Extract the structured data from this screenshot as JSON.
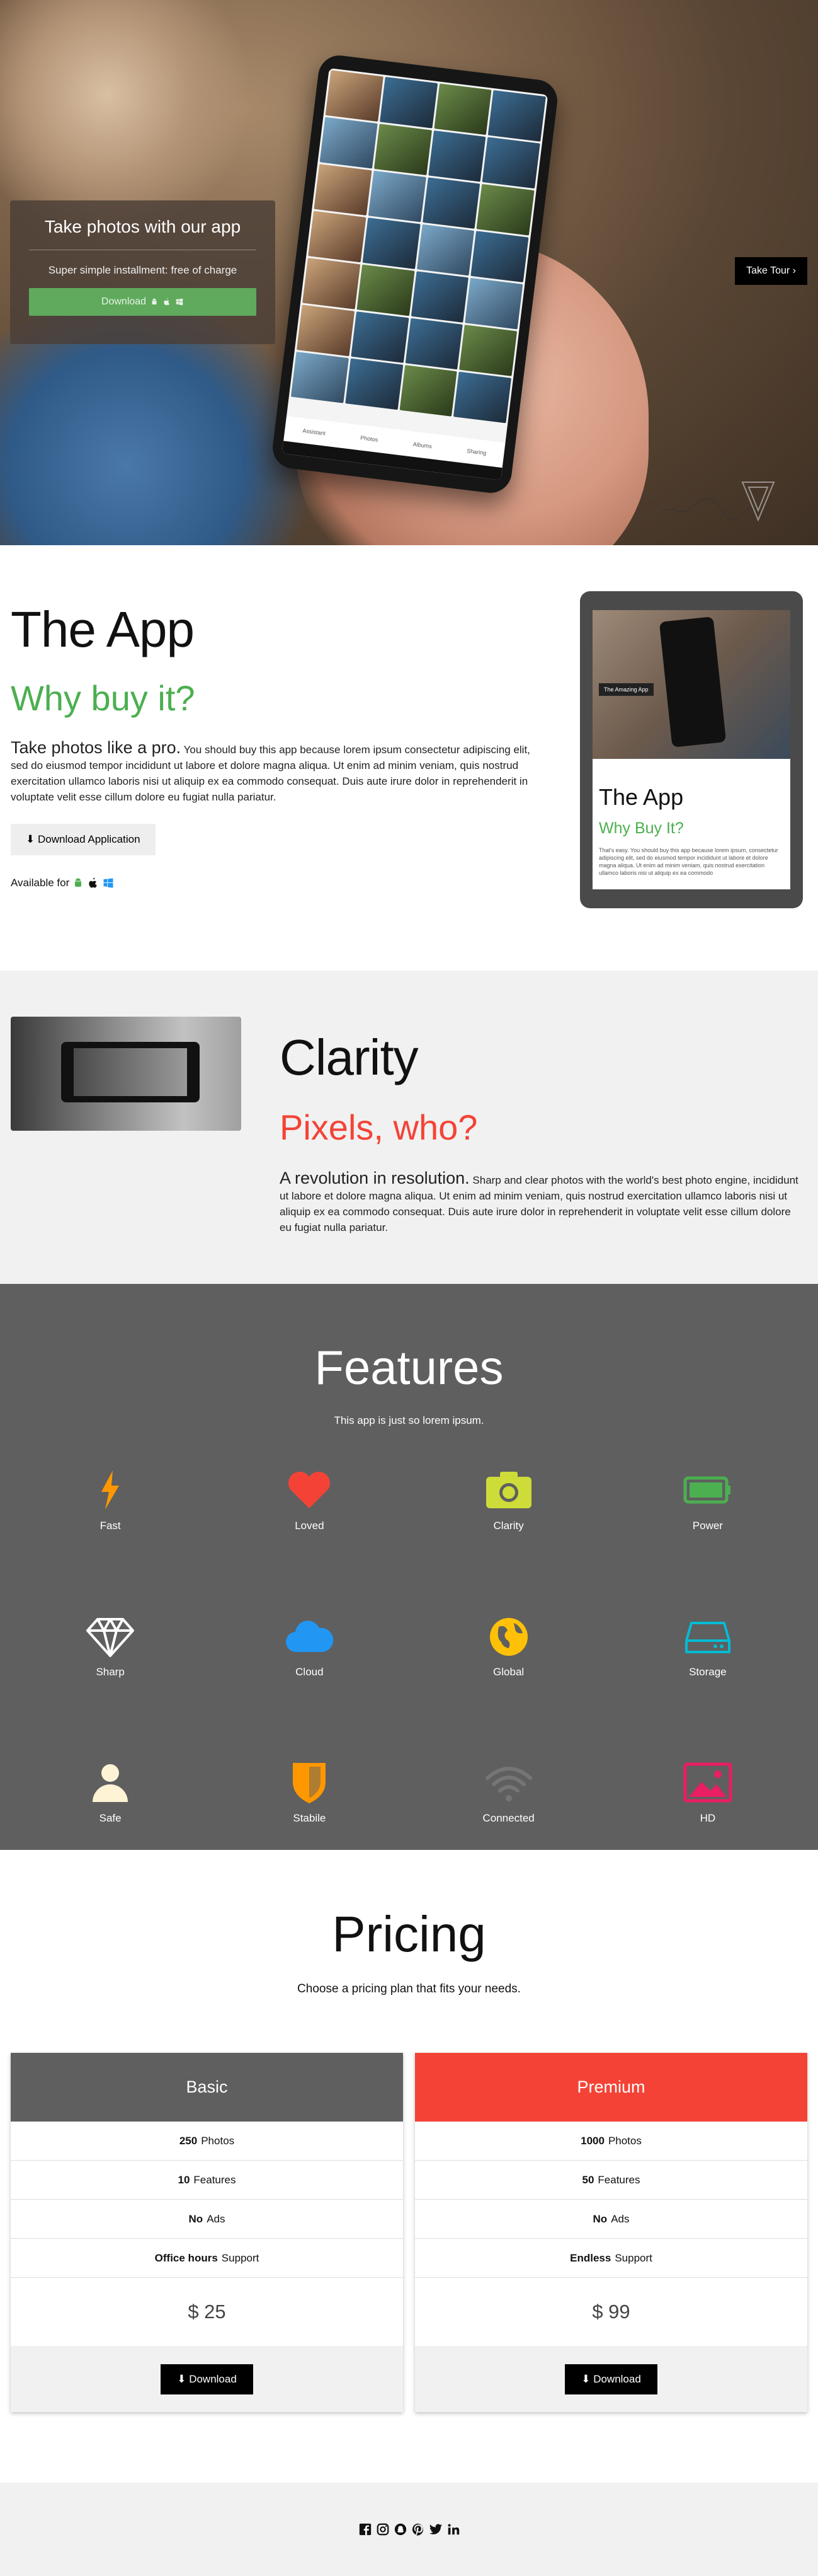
{
  "hero": {
    "card_title": "Take photos with our app",
    "card_subtitle": "Super simple installment: free of charge",
    "download_label": "Download",
    "tour_label": "Take Tour",
    "phone_nav": [
      "Assistant",
      "Photos",
      "Albums",
      "Sharing"
    ]
  },
  "app": {
    "title": "The App",
    "subtitle": "Why buy it?",
    "lead": "Take photos like a pro.",
    "body": "You should buy this app because lorem ipsum consectetur adipiscing elit, sed do eiusmod tempor incididunt ut labore et dolore magna aliqua. Ut enim ad minim veniam, quis nostrud exercitation ullamco laboris nisi ut aliquip ex ea commodo consequat. Duis aute irure dolor in reprehenderit in voluptate velit esse cillum dolore eu fugiat nulla pariatur.",
    "download_label": "Download Application",
    "available_label": "Available for",
    "tablet": {
      "badge": "The Amazing App",
      "title": "The App",
      "subtitle": "Why Buy It?",
      "body": "That's easy. You should buy this app because lorem ipsum, consectetur adipiscing elit, sed do eiusmod tempor incididunt ut labore et dolore magna aliqua. Ut enim ad minim veniam, quis nostrud exercitation ullamco laboris nisi ut aliquip ex ea commodo"
    }
  },
  "clarity": {
    "title": "Clarity",
    "subtitle": "Pixels, who?",
    "lead": "A revolution in resolution.",
    "body": "Sharp and clear photos with the world's best photo engine, incididunt ut labore et dolore magna aliqua. Ut enim ad minim veniam, quis nostrud exercitation ullamco laboris nisi ut aliquip ex ea commodo consequat. Duis aute irure dolor in reprehenderit in voluptate velit esse cillum dolore eu fugiat nulla pariatur."
  },
  "features": {
    "title": "Features",
    "subtitle": "This app is just so lorem ipsum.",
    "items": [
      {
        "label": "Fast",
        "icon": "bolt-icon",
        "color": "#ff9800"
      },
      {
        "label": "Loved",
        "icon": "heart-icon",
        "color": "#f44336"
      },
      {
        "label": "Clarity",
        "icon": "camera-icon",
        "color": "#cddc39"
      },
      {
        "label": "Power",
        "icon": "battery-icon",
        "color": "#4caf50"
      },
      {
        "label": "Sharp",
        "icon": "diamond-icon",
        "color": "#ffffff"
      },
      {
        "label": "Cloud",
        "icon": "cloud-icon",
        "color": "#2196f3"
      },
      {
        "label": "Global",
        "icon": "globe-icon",
        "color": "#ffc107"
      },
      {
        "label": "Storage",
        "icon": "hdd-icon",
        "color": "#00bcd4"
      },
      {
        "label": "Safe",
        "icon": "user-icon",
        "color": "#fff3d6"
      },
      {
        "label": "Stabile",
        "icon": "shield-icon",
        "color": "#ff9800"
      },
      {
        "label": "Connected",
        "icon": "wifi-icon",
        "color": "#757575"
      },
      {
        "label": "HD",
        "icon": "image-icon",
        "color": "#e91e63"
      }
    ]
  },
  "pricing": {
    "title": "Pricing",
    "subtitle": "Choose a pricing plan that fits your needs.",
    "plans": [
      {
        "name": "Basic",
        "color": "#5f5f5f",
        "rows": [
          {
            "strong": "250",
            "text": "Photos"
          },
          {
            "strong": "10",
            "text": "Features"
          },
          {
            "strong": "No",
            "text": "Ads"
          },
          {
            "strong": "Office hours",
            "text": "Support"
          }
        ],
        "price": "$ 25",
        "button": "Download"
      },
      {
        "name": "Premium",
        "color": "#f44336",
        "rows": [
          {
            "strong": "1000",
            "text": "Photos"
          },
          {
            "strong": "50",
            "text": "Features"
          },
          {
            "strong": "No",
            "text": "Ads"
          },
          {
            "strong": "Endless",
            "text": "Support"
          }
        ],
        "price": "$ 99",
        "button": "Download"
      }
    ]
  },
  "footer": {
    "icons": [
      "facebook-icon",
      "instagram-icon",
      "snapchat-icon",
      "pinterest-icon",
      "twitter-icon",
      "linkedin-icon"
    ]
  }
}
